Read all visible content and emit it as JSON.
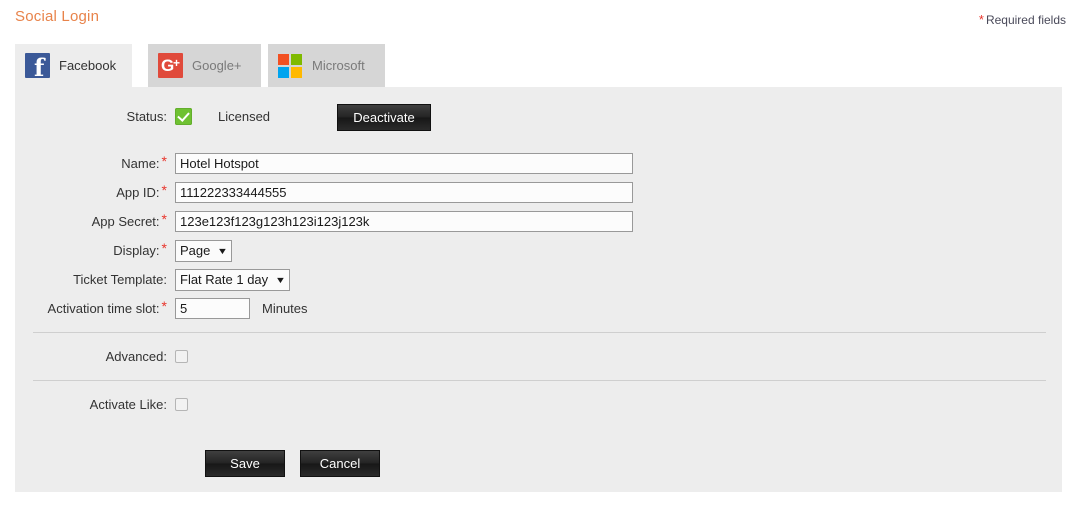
{
  "header": {
    "title": "Social Login",
    "required_note": "Required fields",
    "required_star": "*"
  },
  "tabs": [
    {
      "id": "facebook",
      "label": "Facebook",
      "icon": "facebook-icon",
      "active": true
    },
    {
      "id": "googleplus",
      "label": "Google+",
      "icon": "google-plus-icon",
      "active": false
    },
    {
      "id": "microsoft",
      "label": "Microsoft",
      "icon": "microsoft-icon",
      "active": false
    }
  ],
  "form": {
    "status": {
      "label": "Status:",
      "checked": true,
      "value_text": "Licensed",
      "button_label": "Deactivate"
    },
    "name": {
      "label": "Name:",
      "required": "*",
      "value": "Hotel Hotspot"
    },
    "app_id": {
      "label": "App ID:",
      "required": "*",
      "value": "111222333444555"
    },
    "app_secret": {
      "label": "App Secret:",
      "required": "*",
      "value": "123e123f123g123h123i123j123k"
    },
    "display": {
      "label": "Display:",
      "required": "*",
      "value": "Page",
      "options": [
        "Page"
      ],
      "caret": "▼"
    },
    "ticket_template": {
      "label": "Ticket Template:",
      "value": "Flat Rate 1 day",
      "options": [
        "Flat Rate 1 day"
      ],
      "caret": "▼"
    },
    "activation_time_slot": {
      "label": "Activation time slot:",
      "required": "*",
      "value": "5",
      "unit": "Minutes"
    },
    "advanced": {
      "label": "Advanced:",
      "checked": false
    },
    "activate_like": {
      "label": "Activate Like:",
      "checked": false
    }
  },
  "actions": {
    "save_label": "Save",
    "cancel_label": "Cancel"
  },
  "colors": {
    "title": "#e8834a",
    "required_star": "#e8342b",
    "panel_bg": "#ededed",
    "tab_active_bg": "#ededed",
    "tab_inactive_bg": "#d6d6d6",
    "status_check": "#6fc132",
    "facebook_blue": "#3b5998",
    "google_red": "#e04a3b",
    "ms_red": "#f25022",
    "ms_green": "#7fba00",
    "ms_blue": "#00a4ef",
    "ms_yellow": "#ffb900"
  }
}
